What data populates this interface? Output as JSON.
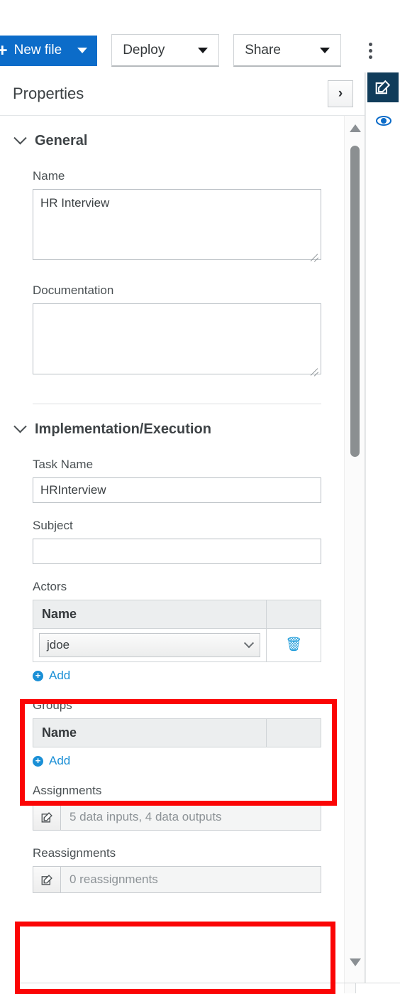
{
  "toolbar": {
    "new_file_label": "New file",
    "new_file_plus": "+",
    "deploy_label": "Deploy",
    "share_label": "Share",
    "kebab_name": "more-options"
  },
  "panel": {
    "title": "Properties",
    "collapse_icon": "›"
  },
  "sections": {
    "general": {
      "title": "General",
      "name_label": "Name",
      "name_value": "HR Interview",
      "documentation_label": "Documentation",
      "documentation_value": ""
    },
    "implementation": {
      "title": "Implementation/Execution",
      "task_name_label": "Task Name",
      "task_name_value": "HRInterview",
      "subject_label": "Subject",
      "subject_value": "",
      "actors_label": "Actors",
      "actors_col_name": "Name",
      "actors_rows": [
        {
          "name": "jdoe"
        }
      ],
      "actors_add_label": "Add",
      "groups_label": "Groups",
      "groups_col_name": "Name",
      "groups_rows": [],
      "groups_add_label": "Add",
      "assignments_label": "Assignments",
      "assignments_value": "5 data inputs, 4 data outputs",
      "reassignments_label": "Reassignments",
      "reassignments_value": "0 reassignments"
    }
  },
  "rail": {
    "edit_tab_name": "properties-tab",
    "eye_name": "preview-tab"
  },
  "colors": {
    "primary_blue": "#0c6cc9",
    "link_blue": "#1a8fd6",
    "highlight_red": "#fb0505",
    "rail_navy": "#103c5a"
  }
}
